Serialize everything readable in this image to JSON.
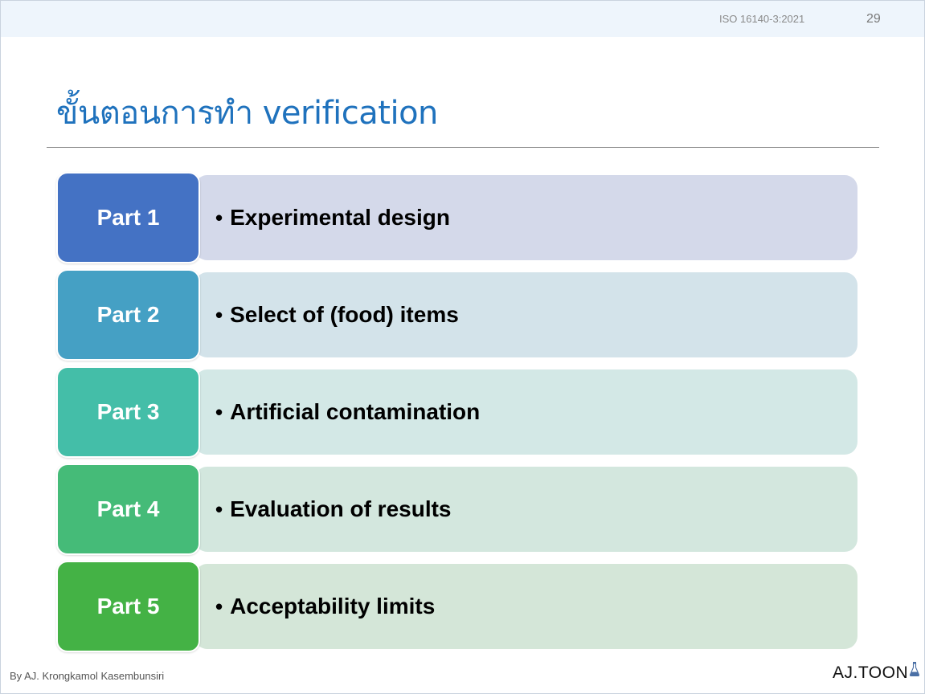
{
  "header": {
    "code": "ISO 16140-3:2021",
    "page_number": "29"
  },
  "title": "ขั้นตอนการทำ verification",
  "parts": [
    {
      "label": "Part 1",
      "text": "Experimental design",
      "tab_color": "#4472c4",
      "bg_color": "#d4d9ea"
    },
    {
      "label": "Part 2",
      "text": "Select of (food) items",
      "tab_color": "#45a0c4",
      "bg_color": "#d3e3ea"
    },
    {
      "label": "Part 3",
      "text": "Artificial contamination",
      "tab_color": "#44bea8",
      "bg_color": "#d3e8e6"
    },
    {
      "label": "Part 4",
      "text": "Evaluation of results",
      "tab_color": "#45bb78",
      "bg_color": "#d3e7de"
    },
    {
      "label": "Part 5",
      "text": "Acceptability limits",
      "tab_color": "#44b245",
      "bg_color": "#d4e6d8"
    }
  ],
  "footer": {
    "author": "By AJ. Krongkamol Kasembunsiri",
    "brand": "AJ.TOON",
    "brand_icon": "flask-icon"
  }
}
